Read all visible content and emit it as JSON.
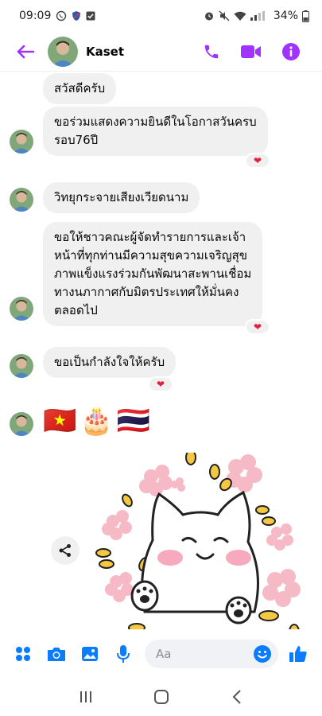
{
  "status_bar": {
    "time": "09:09",
    "battery": "34%"
  },
  "header": {
    "contact_name": "Kaset"
  },
  "colors": {
    "accent": "#a033ff",
    "messenger_blue": "#0a7cff",
    "bubble": "#f0f0f0",
    "reaction": "#e41e3f"
  },
  "messages": [
    {
      "text": "สวัสดีครับ",
      "reaction": ""
    },
    {
      "text": "ขอร่วมแสดงความยินดีในโอกาสวันครบ\nรอบ76ปี",
      "reaction": "❤"
    },
    {
      "text": "วิทยุกระจายเสียงเวียดนาม",
      "reaction": ""
    },
    {
      "text": "ขอให้ชาวคณะผู้จัดทำรายการและเจ้า\nหน้าที่ทุกท่านมีความสุขความเจริญสุข\nภาพแข็งแรงร่วมกันพัฒนาสะพานเชื่อม\nทางนภากาศกับมิตรประเทศให้มั่นคง\nตลอดไป",
      "reaction": "❤"
    },
    {
      "text": "ขอเป็นกำลังใจให้ครับ",
      "reaction": "❤"
    }
  ],
  "emoji_message": {
    "flag_vn": "🇻🇳",
    "cake": "🎂",
    "flag_th": "🇹🇭"
  },
  "composer": {
    "placeholder": "Aa"
  },
  "icons": {
    "header": [
      "back-arrow-icon",
      "phone-icon",
      "video-call-icon",
      "info-icon"
    ],
    "composer": [
      "apps-icon",
      "camera-icon",
      "gallery-icon",
      "microphone-icon",
      "emoji-icon",
      "thumbs-up-icon"
    ],
    "navbar": [
      "recent-apps-icon",
      "home-icon",
      "back-icon"
    ]
  }
}
